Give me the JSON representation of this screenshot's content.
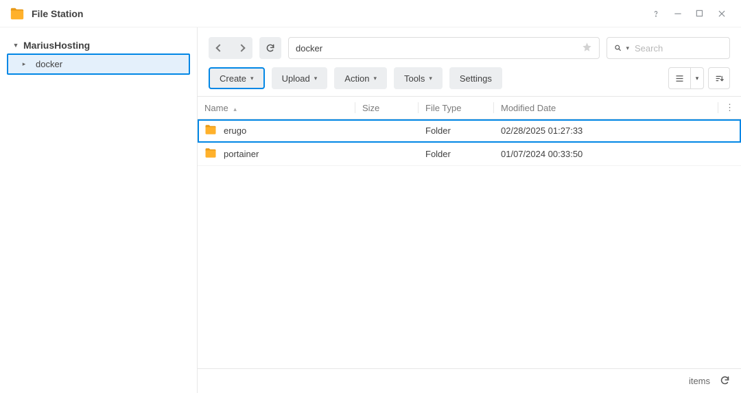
{
  "app": {
    "title": "File Station"
  },
  "sidebar": {
    "root_label": "MariusHosting",
    "nodes": [
      {
        "label": "docker",
        "selected": true
      }
    ]
  },
  "path": {
    "value": "docker"
  },
  "search": {
    "placeholder": "Search"
  },
  "toolbar": {
    "create": "Create",
    "upload": "Upload",
    "action": "Action",
    "tools": "Tools",
    "settings": "Settings"
  },
  "columns": {
    "name": "Name",
    "size": "Size",
    "type": "File Type",
    "modified": "Modified Date"
  },
  "rows": [
    {
      "name": "erugo",
      "size": "",
      "type": "Folder",
      "modified": "02/28/2025 01:27:33",
      "kind": "folder",
      "selected": true
    },
    {
      "name": "portainer",
      "size": "",
      "type": "Folder",
      "modified": "01/07/2024 00:33:50",
      "kind": "folder",
      "selected": false
    }
  ],
  "status": {
    "items_label": "items"
  }
}
